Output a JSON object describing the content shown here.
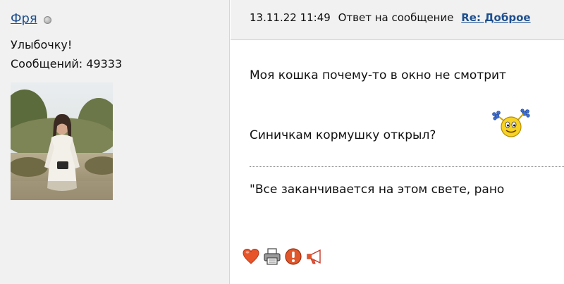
{
  "author": {
    "name": "Фря",
    "title": "Улыбочку!",
    "post_count": "Сообщений: 49333"
  },
  "post": {
    "date": "13.11.22 11:49",
    "reply_label": "Ответ на сообщение",
    "thread_link": "Re: Доброе",
    "lines": [
      "Моя кошка почему-то в окно не смотрит",
      "Синичкам кормушку открыл?"
    ],
    "signature": "\"Все заканчивается на этом свете, рано"
  },
  "actions": [
    {
      "icon": "heart-icon"
    },
    {
      "icon": "print-icon"
    },
    {
      "icon": "report-icon"
    },
    {
      "icon": "megaphone-icon"
    }
  ],
  "colors": {
    "link": "#1d4f8f",
    "sidebar_bg": "#f1f1f1",
    "heart": "#e8542a",
    "report": "#e0572c"
  }
}
